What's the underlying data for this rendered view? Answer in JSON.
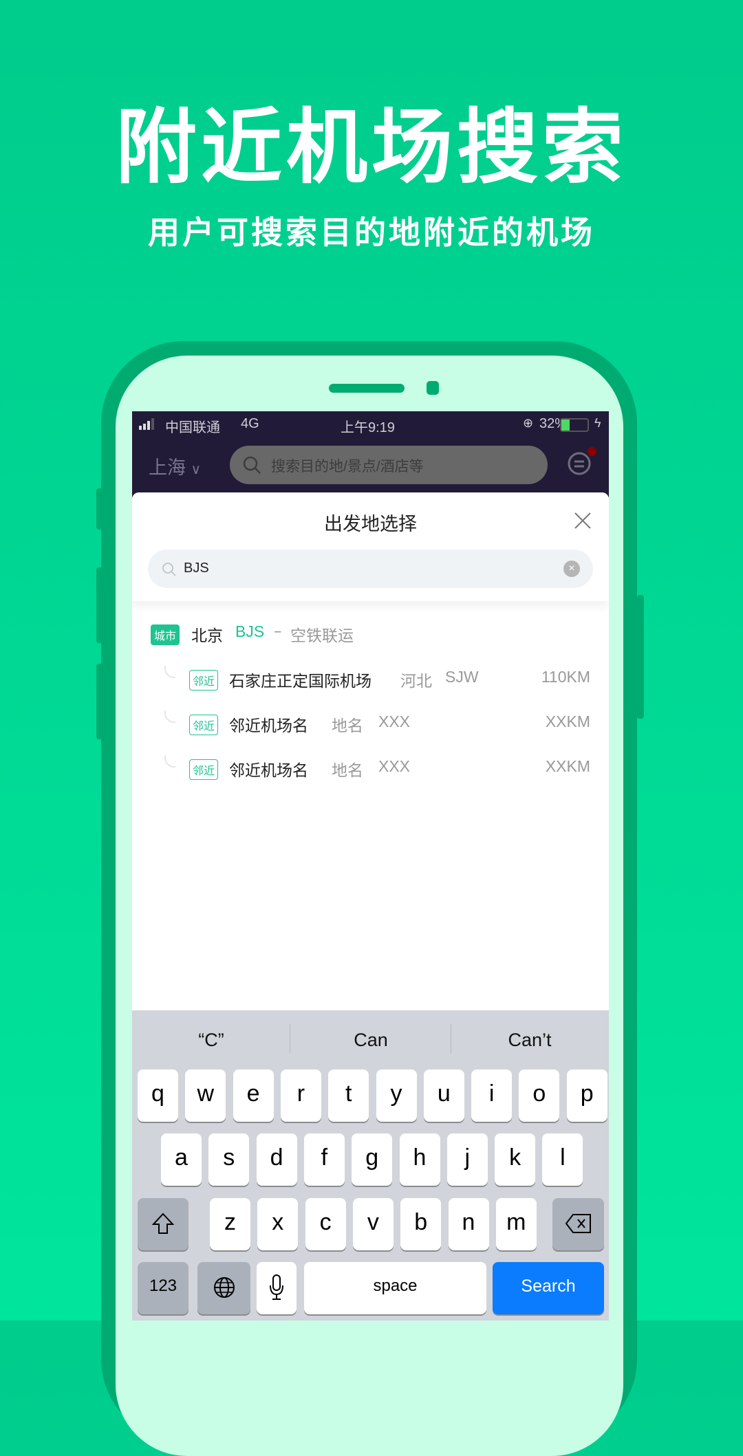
{
  "promo": {
    "title": "附近机场搜索",
    "subtitle": "用户可搜索目的地附近的机场"
  },
  "status_bar": {
    "carrier": "中国联通",
    "network": "4G",
    "time": "上午9:19",
    "battery": "32%",
    "battery_level": 0.32
  },
  "header": {
    "city": "上海",
    "search_placeholder": "搜索目的地/景点/酒店等",
    "has_notification": true
  },
  "sheet": {
    "title": "出发地选择",
    "search_value": "BJS"
  },
  "results": {
    "city": {
      "badge": "城市",
      "name": "北京",
      "code": "BJS",
      "separator": "–",
      "note": "空铁联运"
    },
    "nearby": [
      {
        "tag": "邻近",
        "name": "石家庄正定国际机场",
        "region": "河北",
        "code": "SJW",
        "distance": "110KM"
      },
      {
        "tag": "邻近",
        "name": "邻近机场名",
        "region": "地名",
        "code": "XXX",
        "distance": "XXKM"
      },
      {
        "tag": "邻近",
        "name": "邻近机场名",
        "region": "地名",
        "code": "XXX",
        "distance": "XXKM"
      }
    ]
  },
  "keyboard": {
    "suggestions": [
      "“C”",
      "Can",
      "Can’t"
    ],
    "row1": [
      "q",
      "w",
      "e",
      "r",
      "t",
      "y",
      "u",
      "i",
      "o",
      "p"
    ],
    "row2": [
      "a",
      "s",
      "d",
      "f",
      "g",
      "h",
      "j",
      "k",
      "l"
    ],
    "row3": [
      "z",
      "x",
      "c",
      "v",
      "b",
      "n",
      "m"
    ],
    "numbers": "123",
    "space": "space",
    "search": "Search"
  },
  "colors": {
    "accent": "#1dc48f",
    "background": "#00d894",
    "phone_frame": "#00ab72",
    "search_key": "#0a7cfd"
  }
}
